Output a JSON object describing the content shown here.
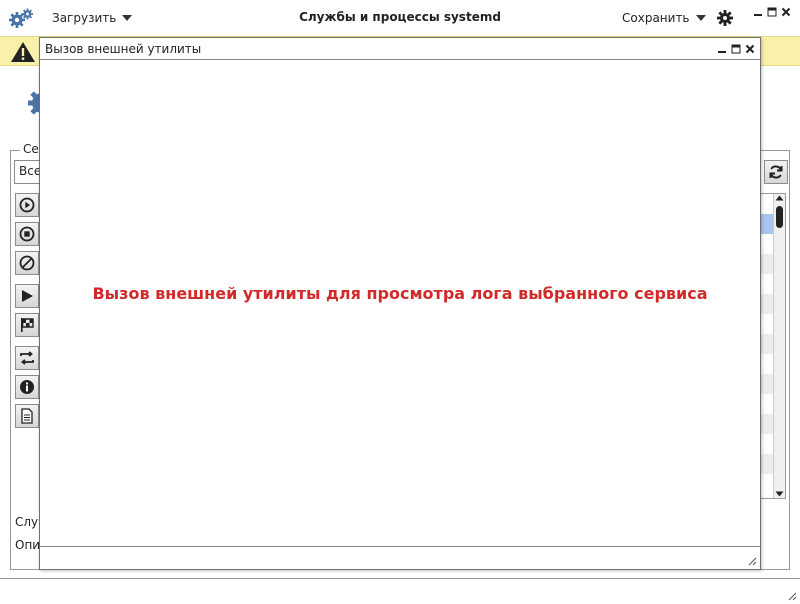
{
  "app": {
    "title": "Службы и процессы systemd",
    "load_menu_label": "Загрузить",
    "save_menu_label": "Сохранить"
  },
  "background": {
    "group_label": "Се",
    "filter_value": "Все",
    "field_label_1": "Слу",
    "field_label_2": "Опи",
    "toolbar_icons": [
      "play-circle-icon",
      "stop-circle-icon",
      "disable-icon",
      "start-icon",
      "flag-icon",
      "restart-icon",
      "info-icon",
      "document-icon"
    ]
  },
  "dialog": {
    "title": "Вызов внешней утилиты",
    "message": "Вызов внешней утилиты для просмотра лога выбранного сервиса"
  },
  "colors": {
    "warning_bg": "#f9f0a9",
    "message_red": "#d22a2a",
    "selection_blue": "#a9c6ee",
    "gear_blue": "#4a74a8"
  }
}
